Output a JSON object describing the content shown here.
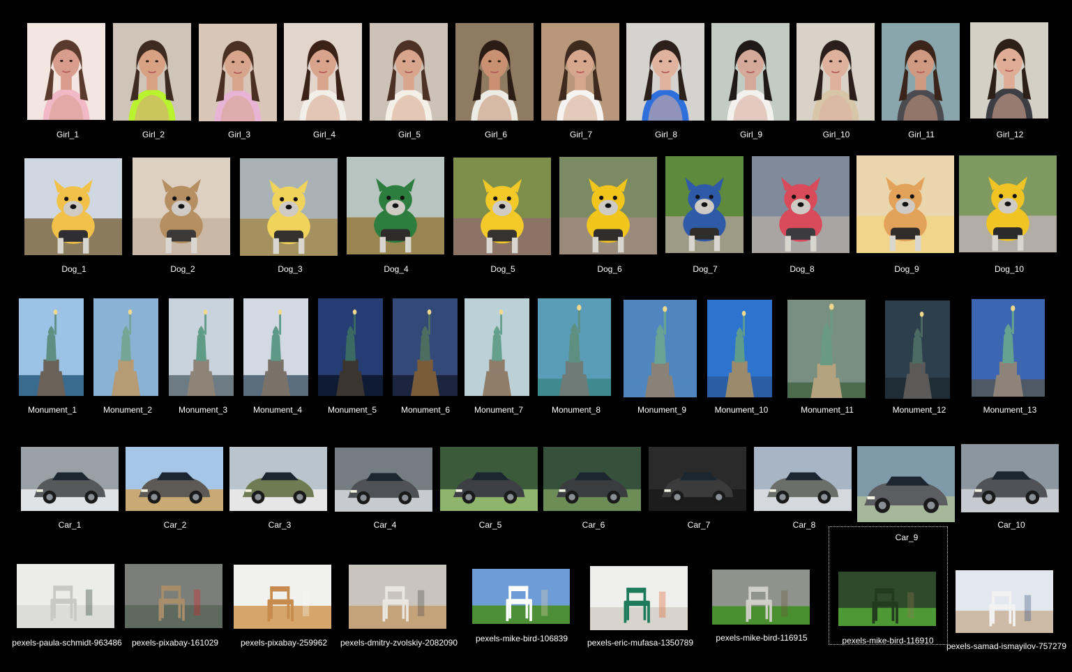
{
  "desktop": {
    "rows": [
      {
        "kind": "girl",
        "items": [
          {
            "label": "Girl_1",
            "palette": [
              "#f3e6e1",
              "#d99d8d",
              "#f0b9c5",
              "#5a3a2c"
            ]
          },
          {
            "label": "Girl_2",
            "palette": [
              "#cfc4b8",
              "#d9a184",
              "#b9f22e",
              "#3d2a20"
            ]
          },
          {
            "label": "Girl_3",
            "palette": [
              "#d8c6b8",
              "#d6a58b",
              "#e8b4d6",
              "#4a3023"
            ]
          },
          {
            "label": "Girl_4",
            "palette": [
              "#e2d5cc",
              "#d9a48c",
              "#f2efe8",
              "#3a2219"
            ]
          },
          {
            "label": "Girl_5",
            "palette": [
              "#cdc2b8",
              "#d8a68d",
              "#f4f0e8",
              "#4d3124"
            ]
          },
          {
            "label": "Girl_6",
            "palette": [
              "#8f7a62",
              "#c99072",
              "#ecebe4",
              "#2b1d16"
            ]
          },
          {
            "label": "Girl_7",
            "palette": [
              "#b9977a",
              "#d6a78c",
              "#f6f4f2",
              "#3f2a20"
            ]
          },
          {
            "label": "Girl_8",
            "palette": [
              "#d5d3d0",
              "#e0b39f",
              "#2f6fdc",
              "#2d1f1a"
            ]
          },
          {
            "label": "Girl_9",
            "palette": [
              "#c2ccc4",
              "#d4a99a",
              "#f3f2ee",
              "#1f1a18"
            ]
          },
          {
            "label": "Girl_10",
            "palette": [
              "#d9d2c6",
              "#ddb19c",
              "#d8c6a8",
              "#2a1f1b"
            ]
          },
          {
            "label": "Girl_11",
            "palette": [
              "#8aa6ad",
              "#cf9a82",
              "#4b4b4f",
              "#3b2419"
            ]
          },
          {
            "label": "Girl_12",
            "palette": [
              "#d4d0c6",
              "#dfad96",
              "#3d3e44",
              "#2c2019"
            ]
          }
        ]
      },
      {
        "kind": "dog",
        "items": [
          {
            "label": "Dog_1",
            "palette": [
              "#cfd7e3",
              "#8a7b5d",
              "#2f2f33",
              "#f2c14a"
            ]
          },
          {
            "label": "Dog_2",
            "palette": [
              "#ddd0c3",
              "#c9b8a6",
              "#3a3937",
              "#b58f62"
            ]
          },
          {
            "label": "Dog_3",
            "palette": [
              "#a9b3b6",
              "#a4915f",
              "#33322f",
              "#f0d35a"
            ]
          },
          {
            "label": "Dog_4",
            "palette": [
              "#b8c4c0",
              "#9a8650",
              "#2d2c2a",
              "#2c7d3e"
            ]
          },
          {
            "label": "Dog_5",
            "palette": [
              "#7d8f4a",
              "#8b7466",
              "#35332f",
              "#f2c928"
            ]
          },
          {
            "label": "Dog_6",
            "palette": [
              "#7a8a63",
              "#9b8b7d",
              "#2f2e2c",
              "#f2c51c"
            ]
          },
          {
            "label": "Dog_7",
            "palette": [
              "#5e8a3d",
              "#9d9a86",
              "#2e2d2b",
              "#2f5aa8"
            ]
          },
          {
            "label": "Dog_8",
            "palette": [
              "#7f8a9a",
              "#a8a5a2",
              "#3b3a3c",
              "#d94a5a"
            ]
          },
          {
            "label": "Dog_9",
            "palette": [
              "#e9d6ae",
              "#f1d58a",
              "#2f2c2a",
              "#e3a25a"
            ]
          },
          {
            "label": "Dog_10",
            "palette": [
              "#7e9a60",
              "#b2aea6",
              "#2b2a2a",
              "#f1c425"
            ]
          }
        ]
      },
      {
        "kind": "monument",
        "items": [
          {
            "label": "Monument_1",
            "palette": [
              "#9cc3e6",
              "#5e8f82",
              "#6a6259",
              "#3a6a8e"
            ]
          },
          {
            "label": "Monument_2",
            "palette": [
              "#89b2d4",
              "#74a595",
              "#b69b74",
              "#89b2d4"
            ]
          },
          {
            "label": "Monument_3",
            "palette": [
              "#c9d3dd",
              "#5f9b85",
              "#8d8377",
              "#6d7b84"
            ]
          },
          {
            "label": "Monument_4",
            "palette": [
              "#d2d9e3",
              "#5e9887",
              "#7a7268",
              "#5a6e80"
            ]
          },
          {
            "label": "Monument_5",
            "palette": [
              "#263d74",
              "#3b6a62",
              "#3b3530",
              "#0f1a33"
            ]
          },
          {
            "label": "Monument_6",
            "palette": [
              "#334a78",
              "#4e6d61",
              "#7a5b3a",
              "#1b2540"
            ]
          },
          {
            "label": "Monument_7",
            "palette": [
              "#bcd0d8",
              "#64a08c",
              "#8f7d6a",
              "#bcd0d8"
            ]
          },
          {
            "label": "Monument_8",
            "palette": [
              "#5a9db8",
              "#5f8f80",
              "#6e7b76",
              "#3f8a8f"
            ]
          },
          {
            "label": "Monument_9",
            "palette": [
              "#4f86c0",
              "#6aa394",
              "#8a8277",
              "#4f86c0"
            ]
          },
          {
            "label": "Monument_10",
            "palette": [
              "#2d74cf",
              "#5f9c8b",
              "#9c8a6d",
              "#2a5ea4"
            ]
          },
          {
            "label": "Monument_11",
            "palette": [
              "#788f82",
              "#6a9a82",
              "#b5a27f",
              "#4d6c4d"
            ]
          },
          {
            "label": "Monument_12",
            "palette": [
              "#2d3e4c",
              "#4b6b62",
              "#5b5a58",
              "#1f2d36"
            ]
          },
          {
            "label": "Monument_13",
            "palette": [
              "#3c66b2",
              "#64a18f",
              "#8d8379",
              "#4e5966"
            ]
          }
        ]
      },
      {
        "kind": "car",
        "items": [
          {
            "label": "Car_1",
            "palette": [
              "#9aa1a6",
              "#d81c28",
              "#55595c",
              "#dfe3e6"
            ]
          },
          {
            "label": "Car_2",
            "palette": [
              "#a6c6e7",
              "#f4f4f4",
              "#5d5a55",
              "#c9a974"
            ]
          },
          {
            "label": "Car_3",
            "palette": [
              "#b9c4cc",
              "#1b1c1f",
              "#6f7b53",
              "#e6e6e6"
            ]
          },
          {
            "label": "Car_4",
            "palette": [
              "#737d82",
              "#8f1d24",
              "#4e5155",
              "#c7cbcf"
            ]
          },
          {
            "label": "Car_5",
            "palette": [
              "#3a5a3a",
              "#d71f3a",
              "#3d3f45",
              "#8fb46b"
            ]
          },
          {
            "label": "Car_6",
            "palette": [
              "#35513b",
              "#c61c22",
              "#3a3c40",
              "#6d8d56"
            ]
          },
          {
            "label": "Car_7",
            "palette": [
              "#2a2a2a",
              "#f2f2f2",
              "#3b3b3b",
              "#1c1c1c"
            ]
          },
          {
            "label": "Car_8",
            "palette": [
              "#a7b5c4",
              "#1f2226",
              "#6b6f6a",
              "#d5d9de"
            ]
          },
          {
            "label": "Car_9",
            "palette": [
              "#7f9aa8",
              "#f5f5f5",
              "#5b5d60",
              "#a5b89a"
            ]
          },
          {
            "label": "Car_10",
            "palette": [
              "#8c96a0",
              "#f6f6f6",
              "#505258",
              "#c5cbd0"
            ]
          }
        ]
      },
      {
        "kind": "chair",
        "items": [
          {
            "label": "pexels-paula-schmidt-963486",
            "palette": [
              "#ececeb",
              "#dcdcdb",
              "#1f3a2c",
              "#c8c8c6"
            ]
          },
          {
            "label": "pexels-pixabay-161029",
            "palette": [
              "#7c7e7a",
              "#5f6a5e",
              "#d7262a",
              "#a88d6a"
            ]
          },
          {
            "label": "pexels-pixabay-259962",
            "palette": [
              "#f1f1ef",
              "#d6a56b",
              "#f5f5f3",
              "#c78b4d"
            ]
          },
          {
            "label": "pexels-dmitry-zvolskiy-2082090",
            "palette": [
              "#c9c4bc",
              "#c4a27a",
              "#4a4c4b",
              "#e9e5df"
            ]
          },
          {
            "label": "pexels-mike-bird-106839",
            "palette": [
              "#6e9cd6",
              "#4c8f37",
              "#d9ccae",
              "#ffffff"
            ]
          },
          {
            "label": "pexels-eric-mufasa-1350789",
            "palette": [
              "#efefed",
              "#d8d4cc",
              "#e2612a",
              "#1d7a5b"
            ]
          },
          {
            "label": "pexels-mike-bird-116915",
            "palette": [
              "#8f938b",
              "#4a8f2f",
              "#6b5a40",
              "#cfcfc8"
            ]
          },
          {
            "label": "pexels-mike-bird-116910",
            "palette": [
              "#2f4a2a",
              "#4d9a35",
              "#8c7552",
              "#223b1e"
            ]
          },
          {
            "label": "pexels-samad-ismayilov-757279",
            "palette": [
              "#e3e8ee",
              "#cdbba7",
              "#36507d",
              "#f2f2f2"
            ]
          }
        ]
      }
    ]
  }
}
